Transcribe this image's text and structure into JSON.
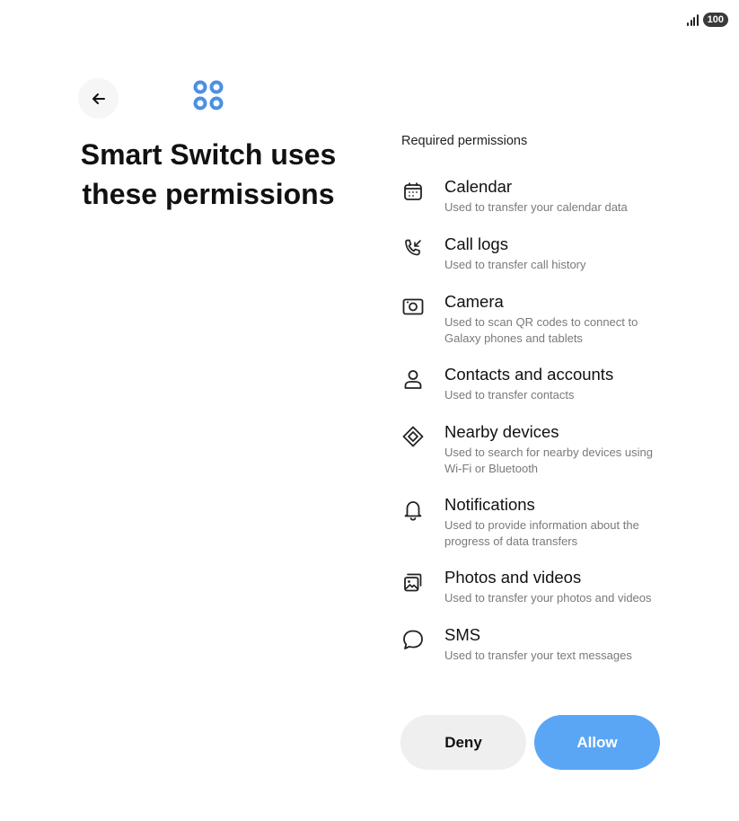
{
  "status_bar": {
    "battery": "100"
  },
  "header": {
    "title": "Smart Switch uses these permissions"
  },
  "permissions": {
    "heading": "Required permissions",
    "items": [
      {
        "icon": "calendar-icon",
        "title": "Calendar",
        "desc": "Used to transfer your calendar data"
      },
      {
        "icon": "call-logs-icon",
        "title": "Call logs",
        "desc": "Used to transfer call history"
      },
      {
        "icon": "camera-icon",
        "title": "Camera",
        "desc": "Used to scan QR codes to connect to Galaxy phones and tablets"
      },
      {
        "icon": "contacts-icon",
        "title": "Contacts and accounts",
        "desc": "Used to transfer contacts"
      },
      {
        "icon": "nearby-devices-icon",
        "title": "Nearby devices",
        "desc": "Used to search for nearby devices using Wi-Fi or Bluetooth"
      },
      {
        "icon": "notifications-icon",
        "title": "Notifications",
        "desc": "Used to provide information about the progress of data transfers"
      },
      {
        "icon": "photos-icon",
        "title": "Photos and videos",
        "desc": "Used to transfer your photos and videos"
      },
      {
        "icon": "sms-icon",
        "title": "SMS",
        "desc": "Used to transfer your text messages"
      }
    ]
  },
  "actions": {
    "deny_label": "Deny",
    "allow_label": "Allow"
  },
  "colors": {
    "accent": "#5aa6f5",
    "logo": "#4a90e2",
    "deny_bg": "#efefef"
  }
}
